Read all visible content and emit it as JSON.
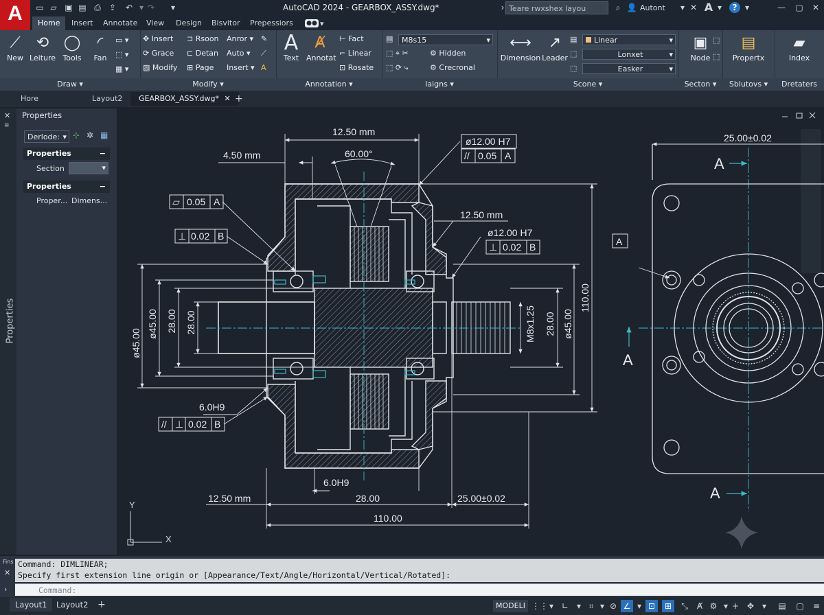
{
  "title_bar": {
    "logo_letter": "A",
    "app_title": "AutoCAD 2024  -  GEARBOX_ASSY.dwg*",
    "search_placeholder": "Teare rwxshex layou",
    "user_name": "Autont",
    "font_glyph": "A",
    "help_glyph": "?"
  },
  "ribbon_tabs": [
    "Home",
    "Insert",
    "Annotate",
    "View",
    "Design",
    "Bisvitor",
    "Prepessiors"
  ],
  "panels": {
    "draw": {
      "label": "Draw",
      "buttons": [
        "New",
        "Leiture",
        "Tools",
        "Fan"
      ]
    },
    "modify": {
      "label": "Modify",
      "col1": [
        "Insert",
        "Grace",
        "Modify"
      ],
      "col2": [
        "Rsoon",
        "Detan",
        "Page"
      ],
      "col3": [
        "Anror",
        "Auto",
        "Insert"
      ]
    },
    "annotation": {
      "label": "Annotation",
      "buttons": [
        "Text",
        "Annotat"
      ],
      "small": [
        "Fact",
        "Linear",
        "Rosate"
      ]
    },
    "layers": {
      "label": "Iaigns",
      "combo": "M8s15",
      "small": [
        "Hidden",
        "Crecronal"
      ]
    },
    "scone": {
      "label": "Scone",
      "buttons": [
        "Dimension",
        "Leader"
      ],
      "combos": [
        "Linear",
        "Lonxet",
        "Easker"
      ]
    },
    "secton": {
      "label": "Secton",
      "button": "Node"
    },
    "sblutovs": {
      "label": "Sblutovs",
      "button": "Propertx"
    },
    "dretaters": {
      "label": "Dretaters",
      "button": "Index"
    }
  },
  "doc_tabs": [
    "Hore",
    "Layout2",
    "GEARBOX_ASSY.dwg*"
  ],
  "properties_palette": {
    "title": "Properties",
    "side_label": "Properties",
    "selector": "Derlode:",
    "sections": [
      {
        "header": "Properties",
        "row_label": "Section",
        "row_value": ""
      },
      {
        "header": "Properties",
        "row_label": "Proper...",
        "row_value": "Dimens..."
      }
    ]
  },
  "drawing": {
    "dimensions": {
      "top_width": "12.50 mm",
      "left_offset": "4.50 mm",
      "angle": "60.00°",
      "right_top": "12.50 mm",
      "bore_dia_left": "ø45.00",
      "dia_45_inner": "ø45.00",
      "dia_28_left": "28.00",
      "dia_28_inner": "28.00",
      "thread": "M8x1.25",
      "dia_28_right": "28.00",
      "dia_45_right": "ø45.00",
      "overall_height": "110.00",
      "fit_left": "6.0H9",
      "fit_bottom": "6.0H9",
      "bottom_left": "12.50 mm",
      "bottom_middle": "28.00",
      "bottom_right": "25.00±0.02",
      "overall_length": "110.00",
      "view_width": "25.00±0.02",
      "hole_tol_1": "ø12.00 H7",
      "hole_tol_2": "ø12.00 H7"
    },
    "frames": {
      "parallel_top": {
        "value": "0.05",
        "datum": "A"
      },
      "parallel_left": {
        "value": "0.05",
        "datum": "A"
      },
      "perp_left": {
        "value": "0.02",
        "datum": "B"
      },
      "perp_right": {
        "value": "0.02",
        "datum": "B"
      },
      "perp_bottom": {
        "value": "0.02",
        "datum": "B"
      }
    },
    "section_labels": [
      "A",
      "A",
      "A"
    ],
    "datum_tag": "A",
    "ucs": {
      "x": "X",
      "y": "Y"
    }
  },
  "command_line": {
    "history": [
      "Command: DIMLINEAR;",
      "Specify first extension line origin or [Appearance/Text/Angle/Horizontal/Vertical/Rotated]:"
    ],
    "placeholder": "Command:"
  },
  "status_bar": {
    "layout_tabs": [
      "Layout1",
      "Layout2"
    ],
    "model_label": "MODELI"
  },
  "colors": {
    "accent_red": "#c5161c",
    "drawing_lines": "#dfe3e8",
    "centerlines": "#3fb8c6",
    "canvas_bg": "#1c232d"
  }
}
